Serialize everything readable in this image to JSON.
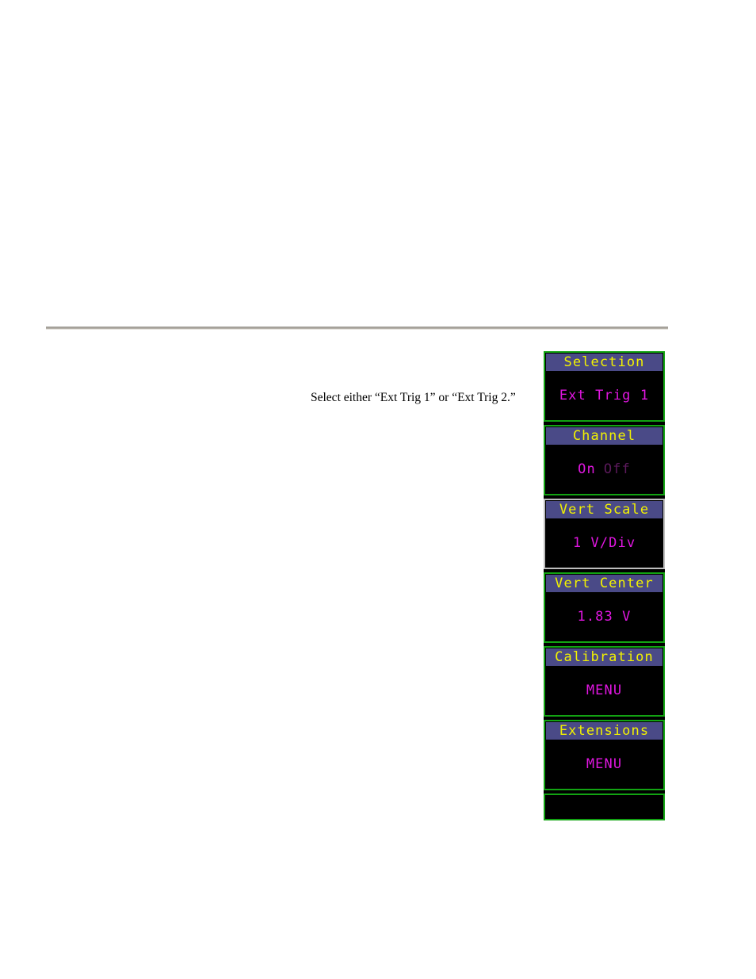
{
  "document": {
    "paragraph": "Select either “Ext Trig 1” or “Ext Trig 2.”"
  },
  "colors": {
    "panel_border_green": "#12a312",
    "panel_border_selected": "#bdbdbd",
    "header_background": "#4a4a87",
    "header_text": "#f2f200",
    "value_text": "#e016e0",
    "value_text_dim": "#5c1a5c",
    "panel_background": "#000000",
    "rule_color": "#b4b0a8"
  },
  "panel": {
    "name": "vertical-softkey-menu",
    "groups": [
      {
        "id": "selection",
        "header": "Selection",
        "value": "Ext Trig 1",
        "selected": false,
        "options": null
      },
      {
        "id": "channel",
        "header": "Channel",
        "value": null,
        "selected": false,
        "options": [
          {
            "label": "On",
            "active": true
          },
          {
            "label": "Off",
            "active": false
          }
        ]
      },
      {
        "id": "vert-scale",
        "header": "Vert Scale",
        "value": "1 V/Div",
        "selected": true,
        "options": null
      },
      {
        "id": "vert-center",
        "header": "Vert Center",
        "value": "1.83 V",
        "selected": false,
        "options": null
      },
      {
        "id": "calibration",
        "header": "Calibration",
        "value": "MENU",
        "selected": false,
        "options": null
      },
      {
        "id": "extensions",
        "header": "Extensions",
        "value": "MENU",
        "selected": false,
        "options": null
      },
      {
        "id": "blank",
        "header": null,
        "value": null,
        "selected": false,
        "options": null
      }
    ]
  }
}
